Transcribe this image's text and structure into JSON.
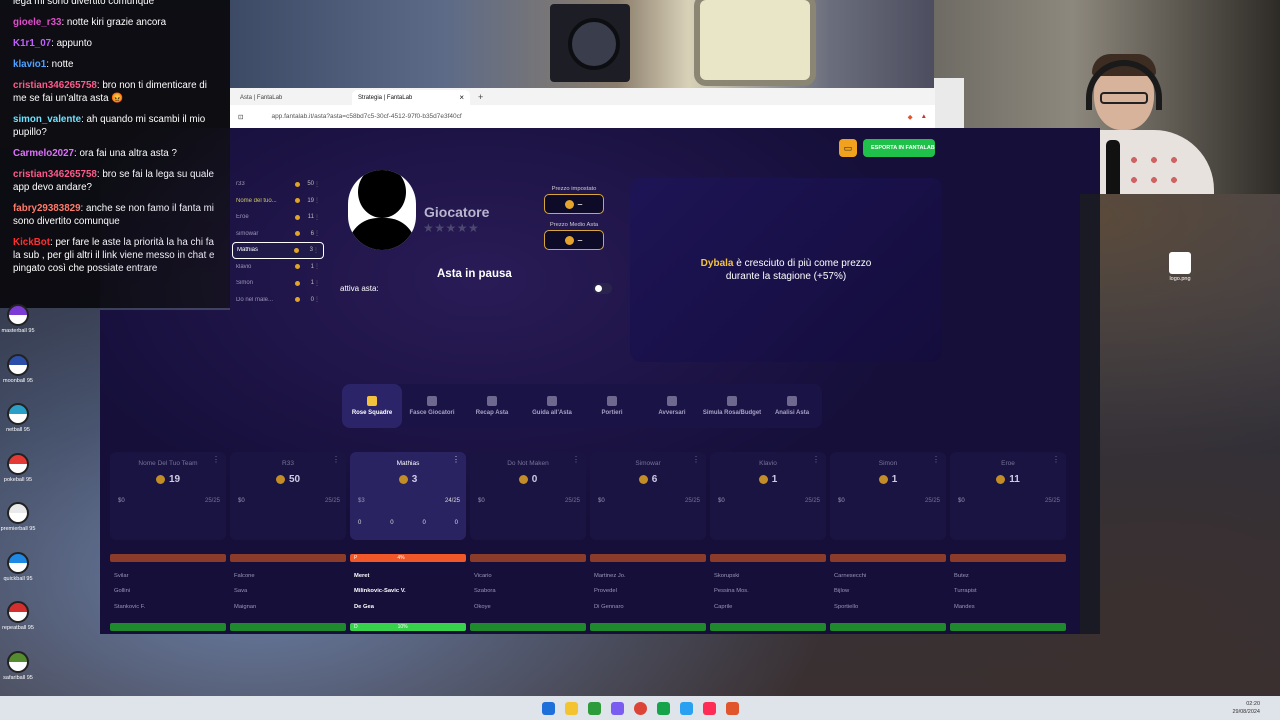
{
  "chat": [
    {
      "user": "",
      "text": "lega mi sono divertito comunque",
      "color": "#ffffff"
    },
    {
      "user": "gioele_r33",
      "text": ": notte kiri grazie ancora",
      "color": "#e04ecb"
    },
    {
      "user": "K1r1_07",
      "text": ": appunto",
      "color": "#c060ff"
    },
    {
      "user": "klavio1",
      "text": ": notte",
      "color": "#4ea3ff"
    },
    {
      "user": "cristian346265758",
      "text": ": bro non ti dimenticare di me se fai un'altra asta 😡",
      "color": "#ff5a8a"
    },
    {
      "user": "simon_valente",
      "text": ": ah quando mi scambi il mio pupillo?",
      "color": "#6fe2ff"
    },
    {
      "user": "Carmelo2027",
      "text": ": ora fai una altra asta ?",
      "color": "#e070ff"
    },
    {
      "user": "cristian346265758",
      "text": ": bro se fai la lega su quale app devo andare?",
      "color": "#ff5a8a"
    },
    {
      "user": "fabry29383829",
      "text": ": anche se non famo il fanta mi sono divertito comunque",
      "color": "#ff7a6a"
    },
    {
      "user": "KickBot",
      "text": ": per fare le aste la priorità la ha chi fa la sub , per gli altri il link viene messo in chat e pingato così che possiate entrare",
      "color": "#ff3030"
    }
  ],
  "browser": {
    "tabs": [
      {
        "label": "Asta | FantaLab"
      },
      {
        "label": "Strategia | FantaLab"
      }
    ],
    "url": "app.fantalab.it/asta?asta=c58bd7c5-30cf-4512-97f0-b35d7e3f40cf"
  },
  "header": {
    "export_label": "ESPORTA IN FANTALAB"
  },
  "ranking": [
    {
      "name": "r33",
      "value": "50",
      "highlight": false
    },
    {
      "name": "Nome del tuo...",
      "value": "19",
      "highlight": true
    },
    {
      "name": "Eroe",
      "value": "11",
      "highlight": false
    },
    {
      "name": "simowar",
      "value": "6",
      "highlight": false
    },
    {
      "name": "Mathias",
      "value": "3",
      "highlight": false,
      "selected": true
    },
    {
      "name": "klavio",
      "value": "1",
      "highlight": false
    },
    {
      "name": "Simon",
      "value": "1",
      "highlight": false
    },
    {
      "name": "Do nel male...",
      "value": "0",
      "highlight": false
    }
  ],
  "player": {
    "name": "Giocatore",
    "stars": "★★★★★",
    "price_set_label": "Prezzo impostato",
    "price_set_value": "–",
    "avg_price_label": "Prezzo Medio Asta",
    "avg_price_value": "–",
    "status": "Asta in pausa",
    "toggle_label": "attiva asta:"
  },
  "insight": {
    "highlight": "Dybala",
    "text_line1": " è cresciuto di più come prezzo",
    "text_line2": "durante la stagione (+57%)"
  },
  "tool_tabs": [
    {
      "label": "Rose Squadre",
      "active": true
    },
    {
      "label": "Fasce Giocatori",
      "active": false
    },
    {
      "label": "Recap Asta",
      "active": false
    },
    {
      "label": "Guida all'Asta",
      "active": false
    },
    {
      "label": "Portieri",
      "active": false
    },
    {
      "label": "Avversari",
      "active": false
    },
    {
      "label": "Simula Rosa/Budget",
      "active": false
    },
    {
      "label": "Analisi Asta",
      "active": false
    }
  ],
  "teams": [
    {
      "name": "Nome Del Tuo Team",
      "credits": "19",
      "mini": "$0",
      "ratio": "25/25",
      "selected": false
    },
    {
      "name": "R33",
      "credits": "50",
      "mini": "$0",
      "ratio": "25/25",
      "selected": false
    },
    {
      "name": "Mathias",
      "credits": "3",
      "mini": "$3",
      "ratio": "24/25",
      "selected": true
    },
    {
      "name": "Do Not Maken",
      "credits": "0",
      "mini": "$0",
      "ratio": "25/25",
      "selected": false
    },
    {
      "name": "Simowar",
      "credits": "6",
      "mini": "$0",
      "ratio": "25/25",
      "selected": false
    },
    {
      "name": "Klavio",
      "credits": "1",
      "mini": "$0",
      "ratio": "25/25",
      "selected": false
    },
    {
      "name": "Simon",
      "credits": "1",
      "mini": "$0",
      "ratio": "25/25",
      "selected": false
    },
    {
      "name": "Eroe",
      "credits": "11",
      "mini": "$0",
      "ratio": "25/25",
      "selected": false
    }
  ],
  "mathias_zeros": [
    "0",
    "0",
    "0",
    "0"
  ],
  "orange_bar_label": "P",
  "orange_bar_pct": "4%",
  "green_bar_label": "D",
  "green_bar_pct": "10%",
  "rosters": [
    [
      "Svilar",
      "Falcone",
      "Meret",
      "Vicario",
      "Martinez Jo.",
      "Skorupski",
      "Carnesecchi",
      "Butez"
    ],
    [
      "Gollini",
      "Sava",
      "Milinkovic-Savic V.",
      "Szabora",
      "Provedel",
      "Pessina Mos.",
      "Bijlow",
      "Turrapist"
    ],
    [
      "Stankovic F.",
      "Maignan",
      "De Gea",
      "Okoye",
      "Di Gennaro",
      "Caprile",
      "Sportiello",
      "Mandes"
    ]
  ],
  "desktop_icons": [
    "masterball 95",
    "moonball 95",
    "netball 95",
    "pokeball 95",
    "premierball 95",
    "quickball 95",
    "repeatball 95",
    "safariball 95"
  ],
  "desktop_right_icons": [
    "logo.png"
  ],
  "clock": {
    "time": "02:20",
    "date": "29/08/2024"
  }
}
